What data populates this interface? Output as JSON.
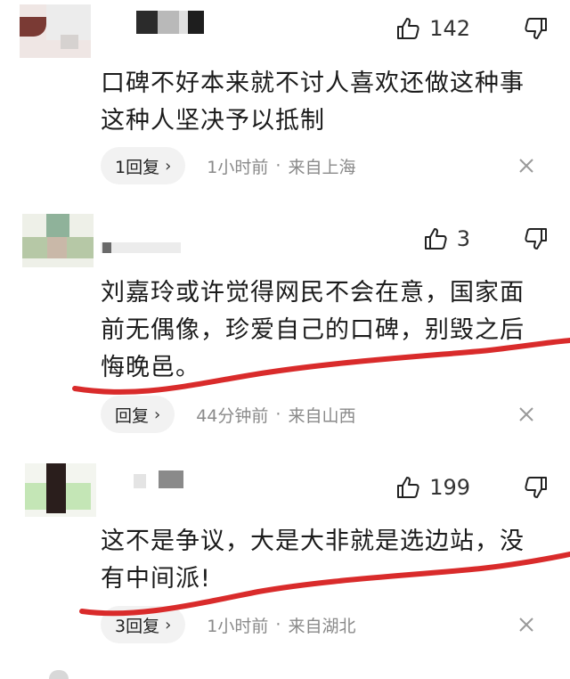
{
  "comments": [
    {
      "likes": "142",
      "lines": [
        "口碑不好本来就不讨人喜欢还做这种事",
        "这种人坚决予以抵制"
      ],
      "reply_label": "1回复",
      "time": "1小时前",
      "sep": "·",
      "location": "来自上海"
    },
    {
      "likes": "3",
      "lines": [
        "刘嘉玲或许觉得网民不会在意，国家面",
        "前无偶像，珍爱自己的口碑，别毁之后",
        "悔晚邑。"
      ],
      "reply_label": "回复",
      "time": "44分钟前",
      "sep": "·",
      "location": "来自山西"
    },
    {
      "likes": "199",
      "lines": [
        "这不是争议，大是大非就是选边站，没",
        "有中间派!"
      ],
      "reply_label": "3回复",
      "time": "1小时前",
      "sep": "·",
      "location": "来自湖北"
    }
  ],
  "icons": {
    "like": "thumbs-up-icon",
    "dislike": "thumbs-down-icon",
    "close": "close-icon",
    "chevron": "chevron-right-icon"
  },
  "colors": {
    "underline": "#d92b2b",
    "meta_text": "#8a8a8a",
    "reply_bg": "#f2f2f2"
  }
}
